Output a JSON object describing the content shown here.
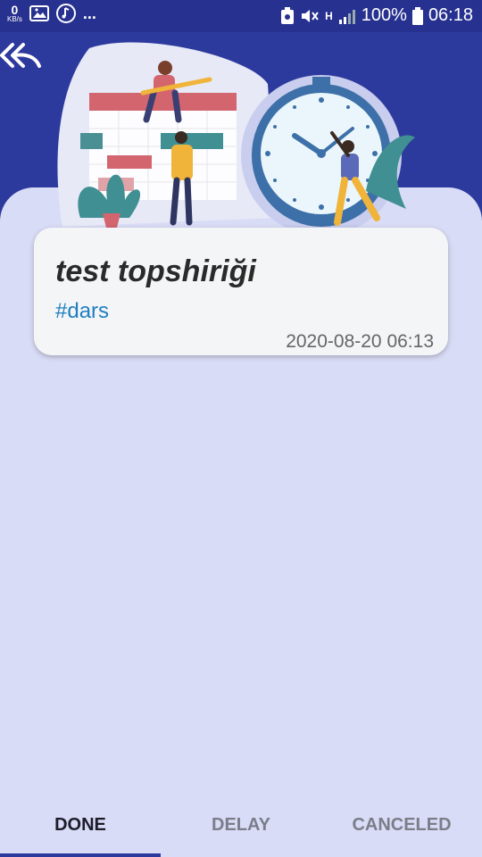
{
  "status_bar": {
    "speed_value": "0",
    "speed_unit": "KB/s",
    "ellipsis": "...",
    "network_type": "H",
    "battery": "100%",
    "time": "06:18"
  },
  "header": {
    "back_icon": "double-back-arrow-icon"
  },
  "task": {
    "title": "test topshiriği",
    "tag": "#dars",
    "datetime": "2020-08-20 06:13"
  },
  "tabs": [
    {
      "label": "DONE",
      "active": true
    },
    {
      "label": "DELAY",
      "active": false
    },
    {
      "label": "CANCELED",
      "active": false
    }
  ],
  "colors": {
    "header_bg": "#2d3a9d",
    "sheet_bg": "#d9dcf6",
    "tag": "#1e7fc0"
  }
}
